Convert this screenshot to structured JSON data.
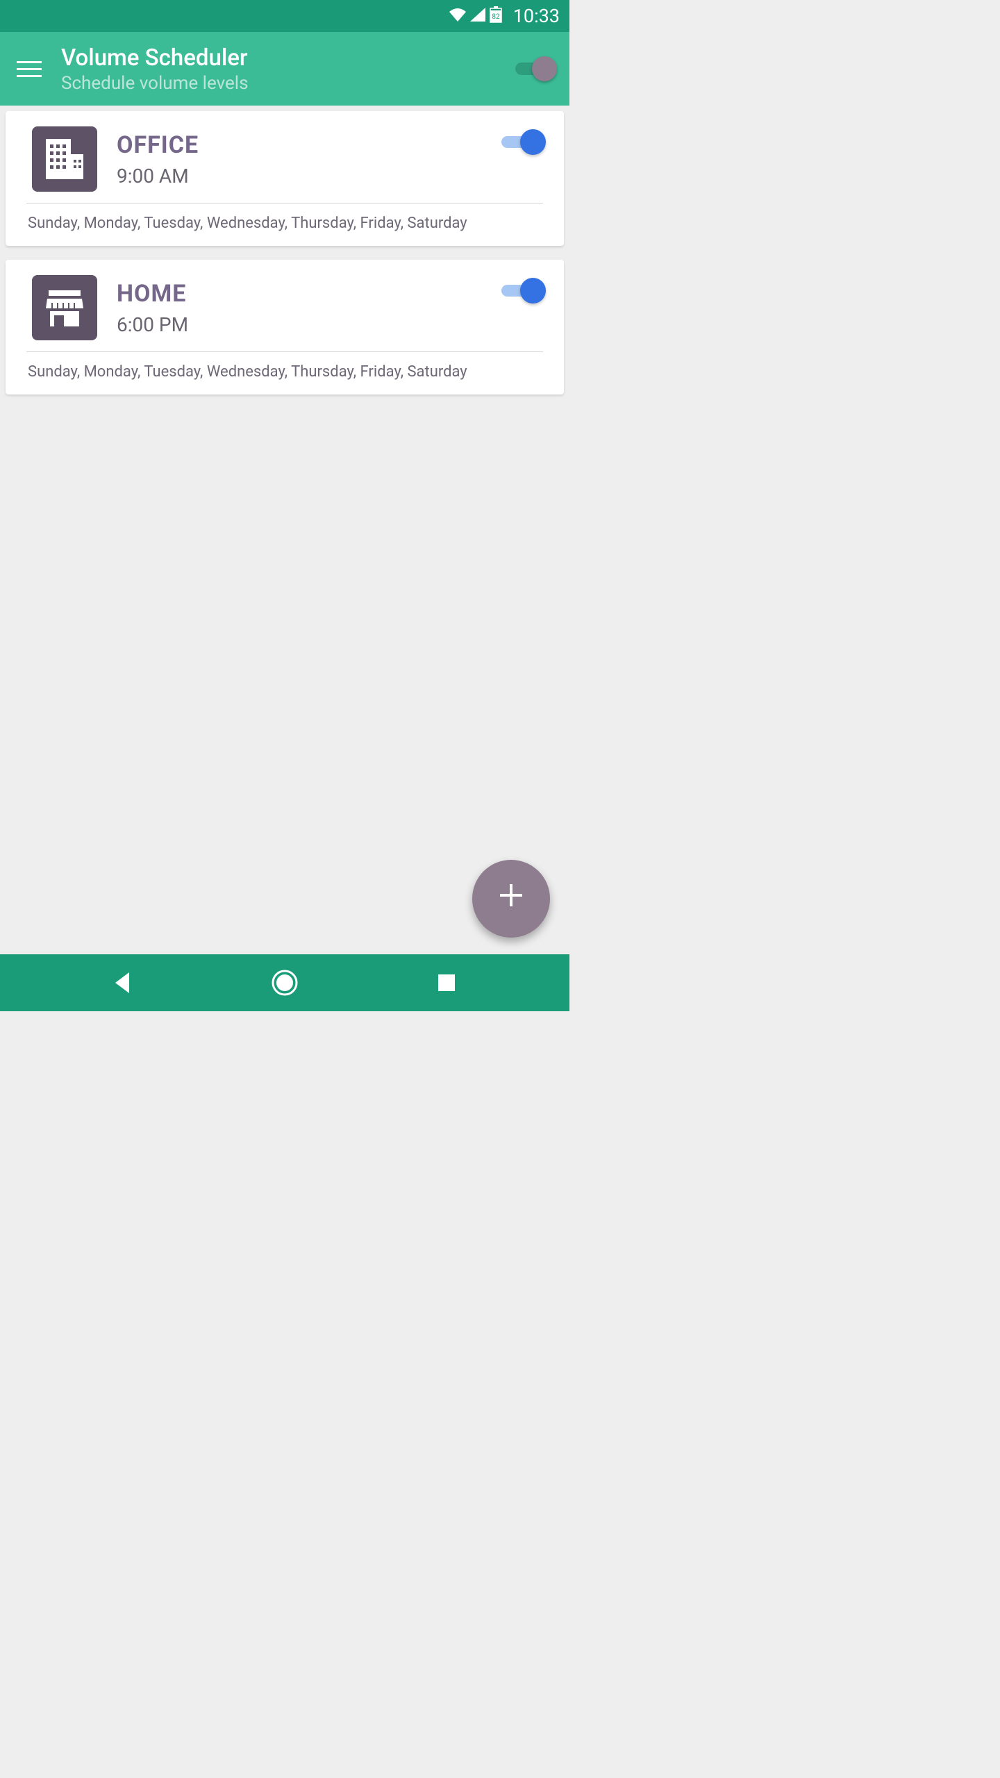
{
  "status": {
    "battery": "82",
    "time": "10:33"
  },
  "appBar": {
    "title": "Volume Scheduler",
    "subtitle": "Schedule volume levels"
  },
  "schedules": [
    {
      "title": "OFFICE",
      "time": "9:00 AM",
      "days": "Sunday, Monday, Tuesday, Wednesday, Thursday, Friday, Saturday",
      "enabled": true,
      "icon": "building"
    },
    {
      "title": "HOME",
      "time": "6:00 PM",
      "days": "Sunday, Monday, Tuesday, Wednesday, Thursday, Friday, Saturday",
      "enabled": true,
      "icon": "store"
    }
  ]
}
